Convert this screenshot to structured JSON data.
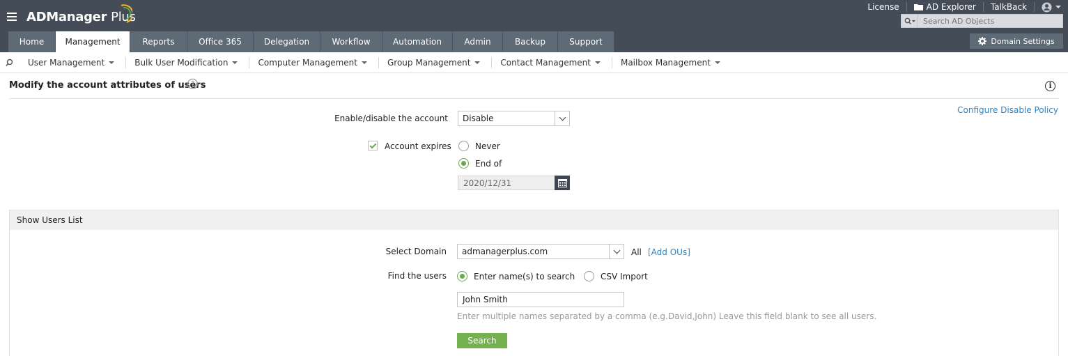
{
  "header": {
    "app_name": "ADManager",
    "app_name_suffix": "Plus",
    "links": {
      "license": "License",
      "ad_explorer": "AD Explorer",
      "talkback": "TalkBack"
    },
    "search_placeholder": "Search AD Objects",
    "domain_settings": "Domain Settings",
    "tabs": [
      {
        "label": "Home",
        "active": false
      },
      {
        "label": "Management",
        "active": true
      },
      {
        "label": "Reports",
        "active": false
      },
      {
        "label": "Office 365",
        "active": false
      },
      {
        "label": "Delegation",
        "active": false
      },
      {
        "label": "Workflow",
        "active": false
      },
      {
        "label": "Automation",
        "active": false
      },
      {
        "label": "Admin",
        "active": false
      },
      {
        "label": "Backup",
        "active": false
      },
      {
        "label": "Support",
        "active": false
      }
    ]
  },
  "subnav": {
    "items": [
      {
        "label": "User Management"
      },
      {
        "label": "Bulk User Modification"
      },
      {
        "label": "Computer Management"
      },
      {
        "label": "Group Management"
      },
      {
        "label": "Contact Management"
      },
      {
        "label": "Mailbox Management"
      }
    ]
  },
  "page": {
    "title": "Modify the account attributes of users",
    "configure_link": "Configure Disable Policy"
  },
  "form": {
    "enable_disable_label": "Enable/disable the account",
    "enable_disable_value": "Disable",
    "account_expires_label": "Account expires",
    "account_expires_checked": true,
    "never_label": "Never",
    "end_of_label": "End of",
    "end_of_selected": true,
    "date_value": "2020/12/31"
  },
  "users_panel": {
    "title": "Show Users List",
    "select_domain_label": "Select Domain",
    "domain_value": "admanagerplus.com",
    "all_label": "All",
    "add_ous_link": "[Add OUs]",
    "find_users_label": "Find the users",
    "enter_names_label": "Enter name(s) to search",
    "csv_import_label": "CSV Import",
    "enter_names_selected": true,
    "name_value": "John Smith",
    "hint": "Enter multiple names separated by a comma (e.g.David,John) Leave this field blank to see all users.",
    "search_button": "Search"
  },
  "colors": {
    "header_bg": "#444c57",
    "tab_bg": "#5e6a76",
    "accent_green": "#76b150",
    "link_blue": "#2a86c8"
  }
}
